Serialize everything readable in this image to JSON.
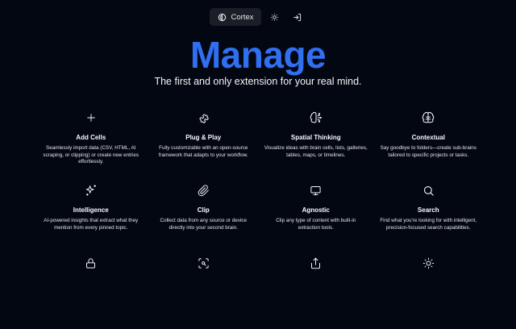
{
  "nav": {
    "brand_label": "Cortex",
    "icons": [
      "cortex-logo-icon",
      "sun-icon",
      "sign-in-icon"
    ]
  },
  "hero": {
    "title": "Manage",
    "subtitle": "The first and only extension for your real mind."
  },
  "features": [
    {
      "icon": "plus-icon",
      "title": "Add Cells",
      "desc": "Seamlessly import data (CSV, HTML, AI scraping, or clipping) or create new entries effortlessly."
    },
    {
      "icon": "puzzle-icon",
      "title": "Plug & Play",
      "desc": "Fully customizable with an open-source framework that adapts to your workflow."
    },
    {
      "icon": "brain-circuit-icon",
      "title": "Spatial Thinking",
      "desc": "Visualize ideas with brain cells, lists, galleries, tables, maps, or timelines."
    },
    {
      "icon": "brain-icon",
      "title": "Contextual",
      "desc": "Say goodbye to folders—create sub-brains tailored to specific projects or tasks."
    },
    {
      "icon": "sparkles-icon",
      "title": "Intelligence",
      "desc": "AI-powered insights that extract what they mention from every pinned topic."
    },
    {
      "icon": "paperclip-icon",
      "title": "Clip",
      "desc": "Collect data from any source or device directly into your second brain."
    },
    {
      "icon": "monitor-icon",
      "title": "Agnostic",
      "desc": "Clip any type of content with built-in extraction tools."
    },
    {
      "icon": "search-icon",
      "title": "Search",
      "desc": "Find what you're looking for with intelligent, precision-focused search capabilities."
    },
    {
      "icon": "lock-icon",
      "title": "",
      "desc": ""
    },
    {
      "icon": "scan-search-icon",
      "title": "",
      "desc": ""
    },
    {
      "icon": "share-icon",
      "title": "",
      "desc": ""
    },
    {
      "icon": "sun-icon",
      "title": "",
      "desc": ""
    }
  ]
}
